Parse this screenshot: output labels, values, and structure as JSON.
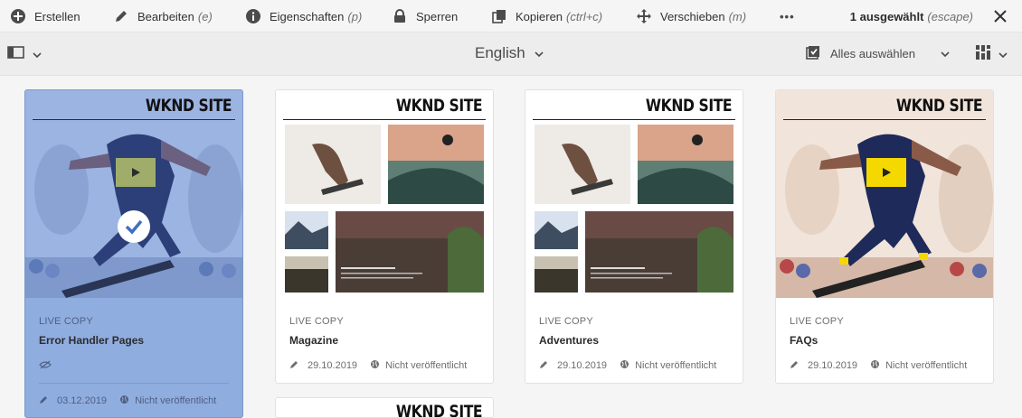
{
  "actionbar": {
    "create": "Erstellen",
    "edit": "Bearbeiten",
    "edit_shortcut": "(e)",
    "properties": "Eigenschaften",
    "properties_shortcut": "(p)",
    "lock": "Sperren",
    "copy": "Kopieren",
    "copy_shortcut": "(ctrl+c)",
    "move": "Verschieben",
    "move_shortcut": "(m)",
    "more": "•••",
    "selected": "1 ausgewählt",
    "selected_shortcut": "(escape)"
  },
  "toolbar": {
    "language": "English",
    "select_all": "Alles auswählen"
  },
  "cards": [
    {
      "brand": "WKND SITE",
      "kind": "LIVE COPY",
      "title": "Error Handler Pages",
      "date": "03.12.2019",
      "status": "Nicht veröffentlicht",
      "selected": true
    },
    {
      "brand": "WKND SITE",
      "kind": "LIVE COPY",
      "title": "Magazine",
      "date": "29.10.2019",
      "status": "Nicht veröffentlicht",
      "selected": false
    },
    {
      "brand": "WKND SITE",
      "kind": "LIVE COPY",
      "title": "Adventures",
      "date": "29.10.2019",
      "status": "Nicht veröffentlicht",
      "selected": false
    },
    {
      "brand": "WKND SITE",
      "kind": "LIVE COPY",
      "title": "FAQs",
      "date": "29.10.2019",
      "status": "Nicht veröffentlicht",
      "selected": false
    },
    {
      "brand": "WKND SITE"
    }
  ],
  "colors": {
    "accent": "#2680eb",
    "selected_card": "#90ade0",
    "play_yellow": "#f5d800"
  }
}
